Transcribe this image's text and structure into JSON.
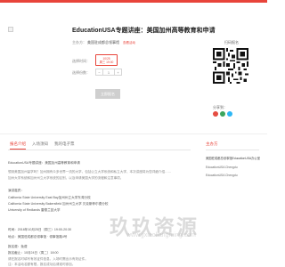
{
  "accent": "#e8443a",
  "event": {
    "title": "EducationUSA专题讲座：美国加州高等教育和申请",
    "organizer_label": "主办方：",
    "organizer": "美国驻成都总领事馆",
    "organizer_tag": "查看活动",
    "session_label": "选择时间：",
    "session_line1": "10/25",
    "session_line2": "周三 19:00",
    "quantity_label": "选择份数：",
    "quantity_minus": "−",
    "quantity_value": "1",
    "quantity_plus": "+",
    "register_button": "立即报名"
  },
  "qr": {
    "title": "扫码报名",
    "share_label": "分享到："
  },
  "tabs": [
    {
      "label": "报名介绍"
    },
    {
      "label": "入场须知"
    },
    {
      "label": "我的电子票"
    }
  ],
  "sidebar": {
    "title": "主办方",
    "org": "美国驻成都总领事馆EducationUSA办公室",
    "detail1": "EducationUSA Chengdu",
    "detail2": "EducationUSA Chengdu"
  },
  "body": {
    "line1": "EducationUSA专题讲座：美国加州高等教育和申请",
    "line2": "想到美国加州留学吗？加州拥有众多世界一流的大学，包括公立大学系统和私立大学，本次讲座将为您详细介绍……",
    "line3": "加州大学系统和加州州立大学系统的区别，以及申请美国大学的流程和注意事项。",
    "speakers_title": "演讲嘉宾：",
    "speaker1": "California State University East Bay加州州立大学东湾分校",
    "speaker2": "California State University Bakersfield 加州州立大学 贝克斯菲尔德分校",
    "speaker3": "University of Redlands 雷德兰兹大学",
    "time_line": "时间：2018年10月25日（周三）19:00-20:30",
    "place_line": "地点：美国驻成都总领事馆 · 领事馆路4号",
    "fee_line": "报名费：免费",
    "deadline_line": "报名截止：10月24日（周二）18:00",
    "note_line": "请在报名时填写有效证件信息，入场时需出示有效证件。",
    "note_line2": "注：本活动名额有限，报名成功后请准时参加。"
  },
  "watermark": {
    "text": "玖玖资源",
    "url": "www.jjxiaoliangming.com"
  },
  "share_colors": [
    "#e54d42",
    "#3ba55d",
    "#2db7f5"
  ]
}
